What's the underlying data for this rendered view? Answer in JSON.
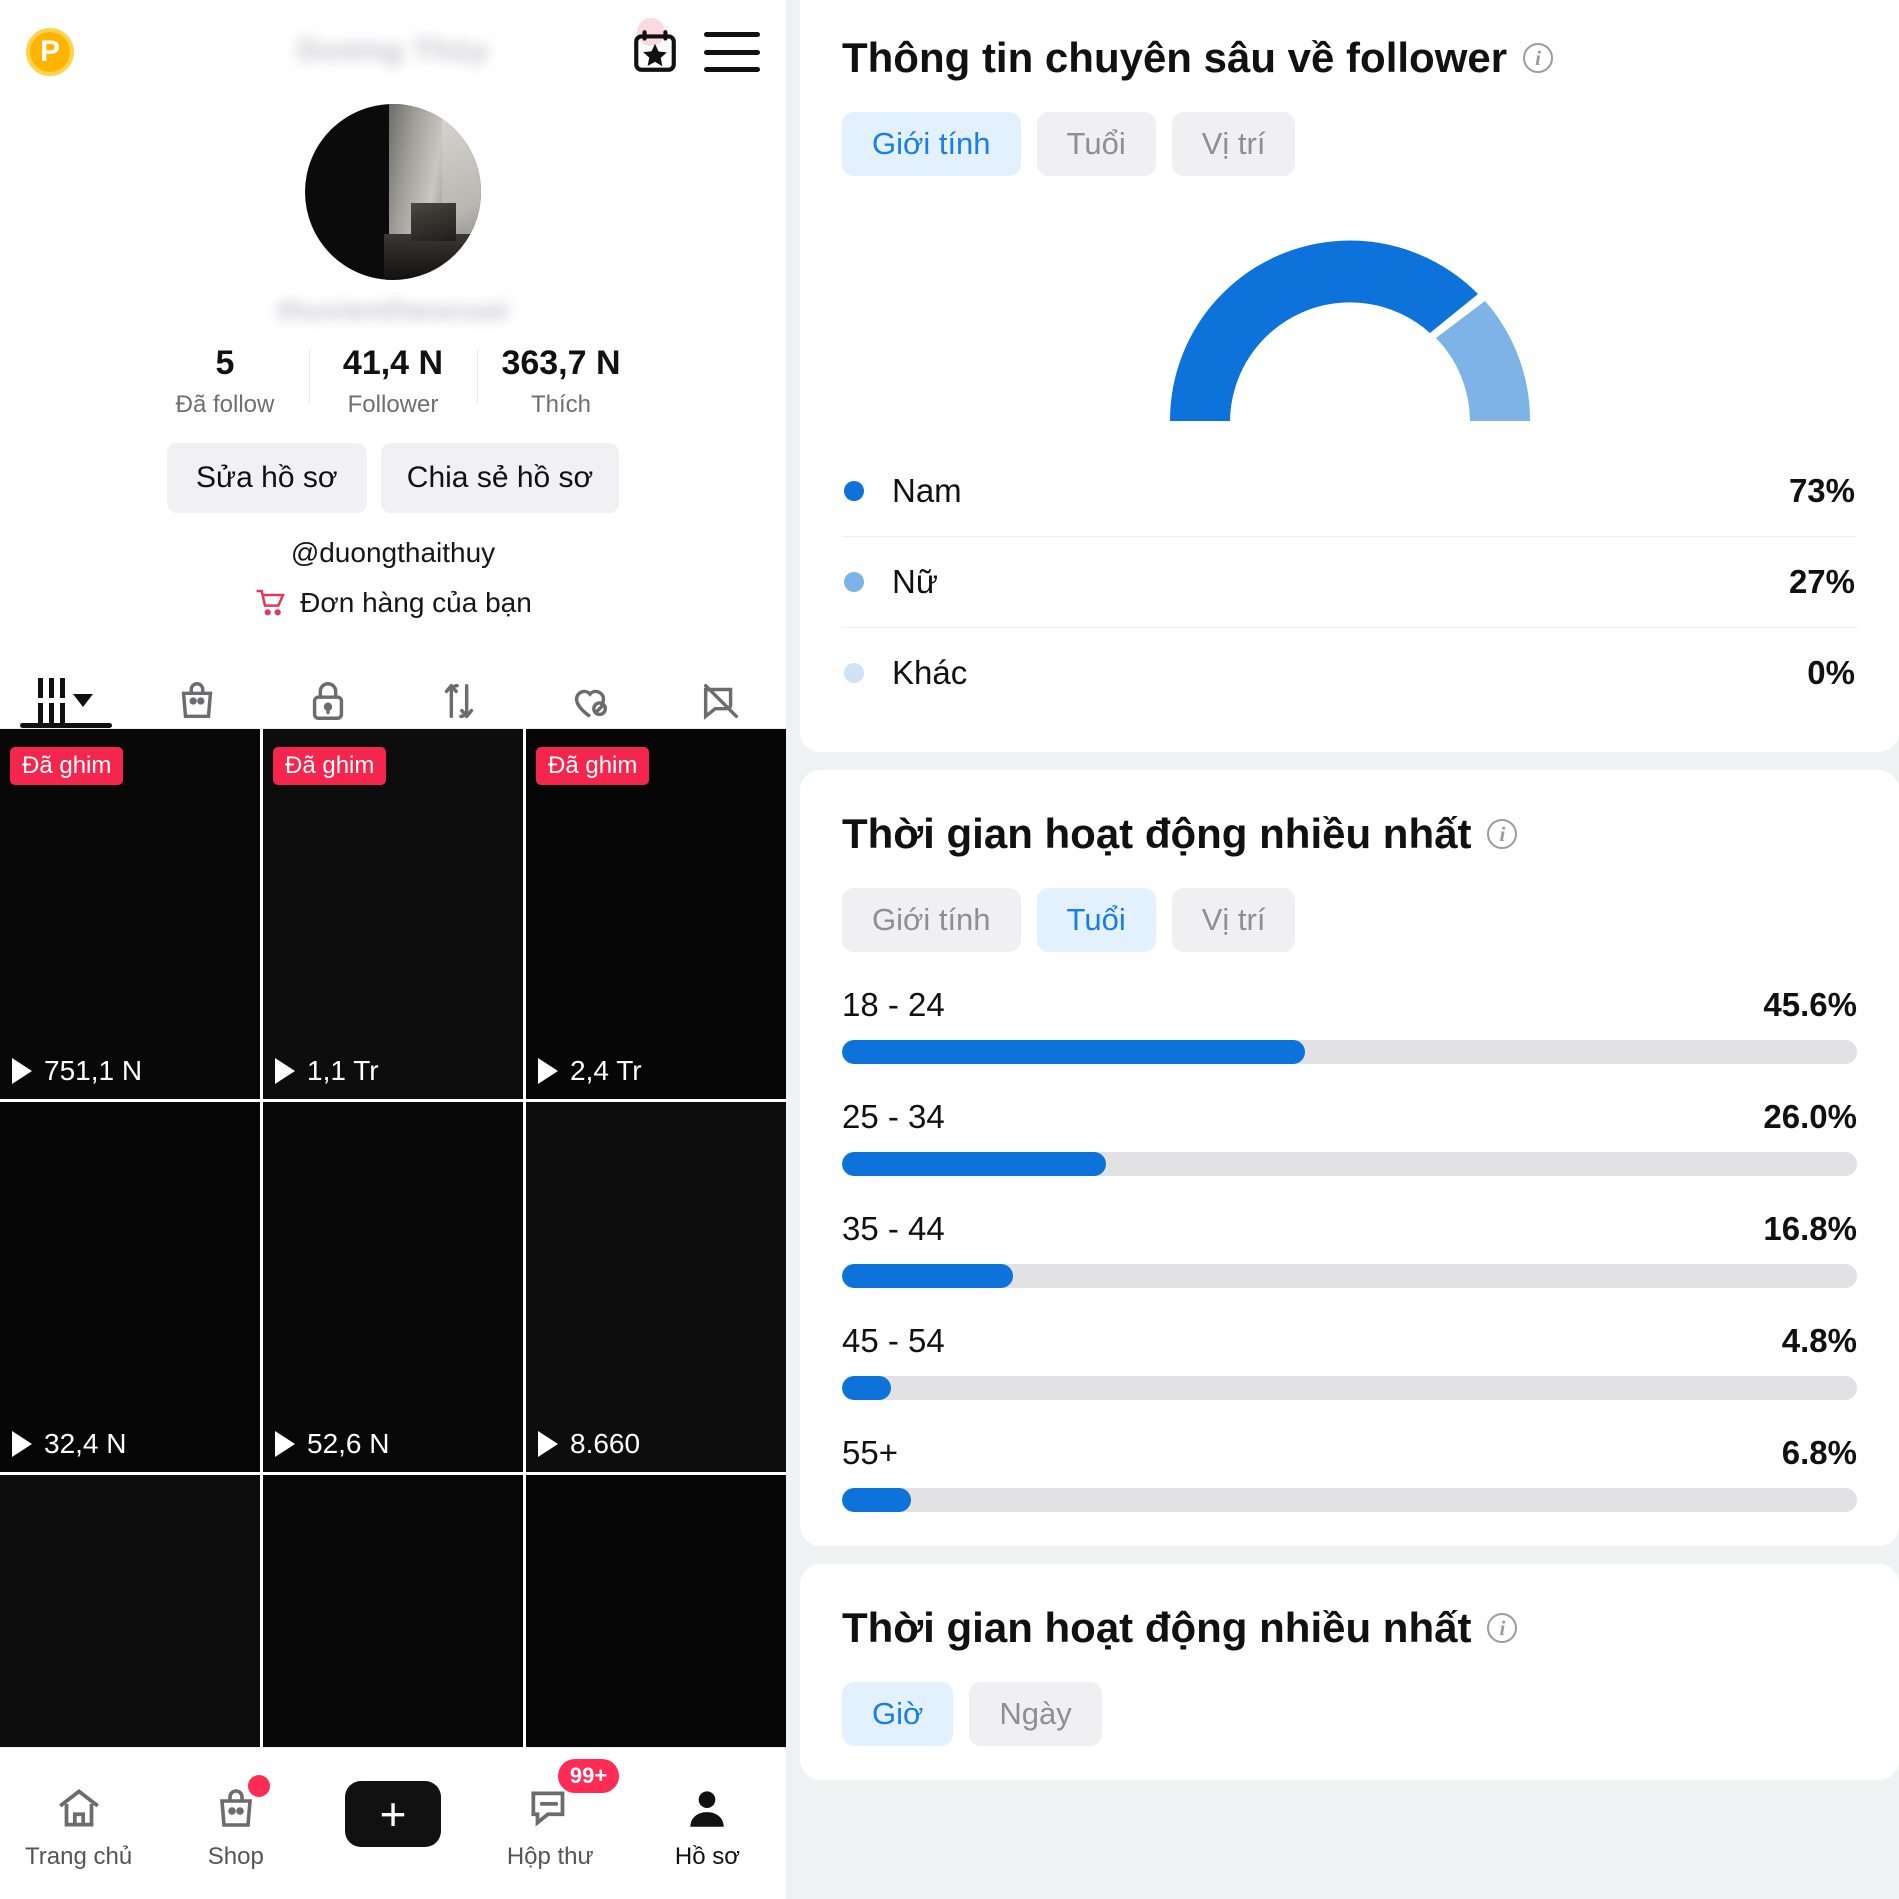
{
  "profile": {
    "badge_letter": "P",
    "blurred_display_name": "Dương Thùy",
    "blurred_bio_line": "thuvientheocuoi",
    "handle": "@duongthaithuy",
    "orders_label": "Đơn hàng của bạn",
    "stats": [
      {
        "num": "5",
        "label": "Đã follow"
      },
      {
        "num": "41,4 N",
        "label": "Follower"
      },
      {
        "num": "363,7 N",
        "label": "Thích"
      }
    ],
    "buttons": [
      {
        "label": "Sửa hồ sơ"
      },
      {
        "label": "Chia sẻ hồ sơ"
      }
    ],
    "tabs": [
      {
        "name": "grid",
        "active": true
      },
      {
        "name": "shop-bag",
        "active": false
      },
      {
        "name": "lock",
        "active": false
      },
      {
        "name": "repost",
        "active": false
      },
      {
        "name": "liked-hidden",
        "active": false
      },
      {
        "name": "tagged-hidden",
        "active": false
      }
    ],
    "videos": [
      {
        "pinned_label": "Đã ghim",
        "pinned": true,
        "views": "751,1 N"
      },
      {
        "pinned_label": "Đã ghim",
        "pinned": true,
        "views": "1,1 Tr"
      },
      {
        "pinned_label": "Đã ghim",
        "pinned": true,
        "views": "2,4 Tr"
      },
      {
        "pinned": false,
        "views": "32,4 N"
      },
      {
        "pinned": false,
        "views": "52,6 N"
      },
      {
        "pinned": false,
        "views": "8.660"
      },
      {
        "pinned": false,
        "views": ""
      },
      {
        "pinned": false,
        "views": ""
      },
      {
        "pinned": false,
        "views": ""
      }
    ],
    "bottom_nav": [
      {
        "label": "Trang chủ",
        "icon": "home-icon",
        "active": false
      },
      {
        "label": "Shop",
        "icon": "shop-bag-icon",
        "active": false,
        "dot": true
      },
      {
        "label": "",
        "icon": "create-plus-icon",
        "active": false
      },
      {
        "label": "Hộp thư",
        "icon": "inbox-icon",
        "active": false,
        "badge": "99+"
      },
      {
        "label": "Hồ sơ",
        "icon": "profile-person-icon",
        "active": true
      }
    ]
  },
  "analytics": {
    "follower_insights": {
      "title": "Thông tin chuyên sâu về follower",
      "tabs": [
        {
          "label": "Giới tính",
          "active": true
        },
        {
          "label": "Tuổi",
          "active": false
        },
        {
          "label": "Vị trí",
          "active": false
        }
      ],
      "legend": [
        {
          "label": "Nam",
          "value": "73%",
          "color": "#0d72d9"
        },
        {
          "label": "Nữ",
          "value": "27%",
          "color": "#7eb3e8"
        },
        {
          "label": "Khác",
          "value": "0%",
          "color": "#cfe3f7"
        }
      ]
    },
    "most_active_age": {
      "title": "Thời gian hoạt động nhiều nhất",
      "tabs": [
        {
          "label": "Giới tính",
          "active": false
        },
        {
          "label": "Tuổi",
          "active": true
        },
        {
          "label": "Vị trí",
          "active": false
        }
      ]
    },
    "most_active_time": {
      "title": "Thời gian hoạt động nhiều nhất",
      "tabs": [
        {
          "label": "Giờ",
          "active": true
        },
        {
          "label": "Ngày",
          "active": false
        }
      ]
    }
  },
  "chart_data": [
    {
      "type": "pie",
      "title": "Thông tin chuyên sâu về follower — Giới tính",
      "subtitle": "Semi-circular donut gauge",
      "labels": [
        "Nam",
        "Nữ",
        "Khác"
      ],
      "values": [
        73,
        27,
        0
      ],
      "value_labels": [
        "73%",
        "27%",
        "0%"
      ],
      "colors": [
        "#0d72d9",
        "#7eb3e8",
        "#cfe3f7"
      ],
      "legend_position": "below",
      "unit": "%"
    },
    {
      "type": "bar",
      "title": "Thời gian hoạt động nhiều nhất — Tuổi",
      "orientation": "horizontal",
      "categories": [
        "18 - 24",
        "25 - 34",
        "35 - 44",
        "45 - 54",
        "55+"
      ],
      "values": [
        45.6,
        26.0,
        16.8,
        4.8,
        6.8
      ],
      "value_labels": [
        "45.6%",
        "26.0%",
        "16.8%",
        "4.8%",
        "6.8%"
      ],
      "xlabel": "",
      "ylabel": "",
      "xlim": [
        0,
        100
      ],
      "grid": false,
      "bar_color": "#0d72d9",
      "track_color": "#e2e2e4"
    }
  ]
}
